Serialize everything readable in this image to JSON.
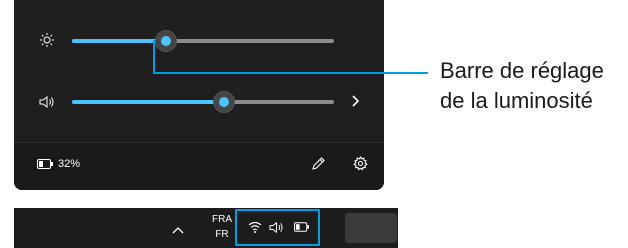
{
  "quick_settings": {
    "brightness": {
      "icon": "brightness-icon",
      "level": 0.36
    },
    "volume": {
      "icon": "volume-icon",
      "level": 0.58,
      "expand_icon": "chevron-right-icon"
    },
    "battery": {
      "icon": "battery-icon",
      "percent_label": "32%"
    },
    "edit_icon": "pencil-icon",
    "settings_icon": "gear-icon"
  },
  "taskbar": {
    "overflow_icon": "chevron-up-icon",
    "language_line1": "FRA",
    "language_line2": "FR",
    "tray_icons": [
      "wifi-icon",
      "volume-icon",
      "battery-icon"
    ]
  },
  "callout": {
    "line1": "Barre de réglage",
    "line2": "de la luminosité"
  },
  "colors": {
    "accent": "#4cc2ff",
    "callout": "#009ee3",
    "panel": "#1f1f1f"
  }
}
